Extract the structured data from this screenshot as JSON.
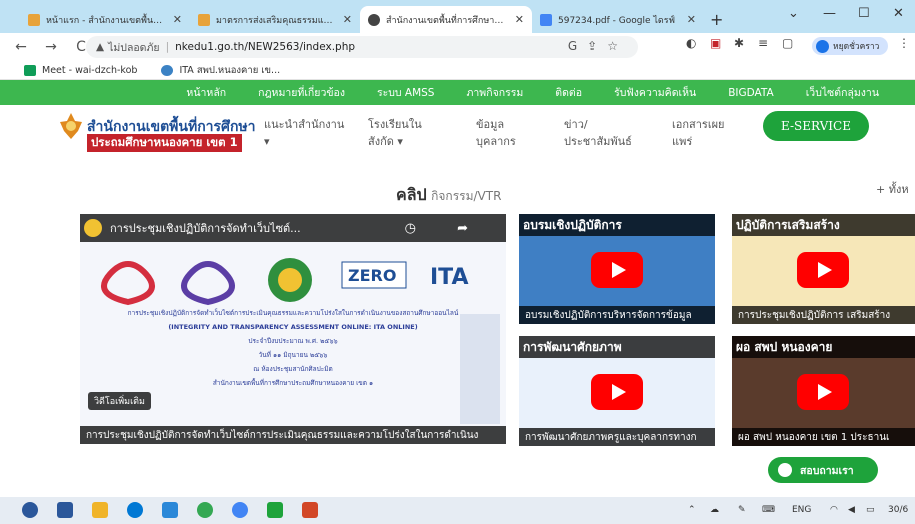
{
  "browser": {
    "tabs": [
      {
        "title": "หน้าแรก - สำนักงานเขตพื้นที่กา",
        "active": false
      },
      {
        "title": "มาตรการส่งเสริมคุณธรรมและความ",
        "active": false
      },
      {
        "title": "สำนักงานเขตพื้นที่การศึกษาประ",
        "active": true
      },
      {
        "title": "597234.pdf - Google ไดรฟ์",
        "active": false
      }
    ],
    "omnibox": {
      "security_label": "ไม่ปลอดภัย",
      "url": "nkedu1.go.th/NEW2563/index.php"
    },
    "profile_label": "หยุดชั่วคราว",
    "bookmarks": [
      {
        "label": "Meet - wai-dzch-kob"
      },
      {
        "label": "ITA สพป.หนองคาย เข..."
      }
    ]
  },
  "site": {
    "topnav": [
      "หน้าหลัก",
      "กฎหมายที่เกี่ยวข้อง",
      "ระบบ AMSS",
      "ภาพกิจกรรม",
      "ติดต่อ",
      "รับฟังความคิดเห็น",
      "BIGDATA",
      "เว็บไซต์กลุ่มงาน"
    ],
    "org_line1": "สำนักงานเขตพื้นที่การศึกษา",
    "org_line2": "ประถมศึกษาหนองคาย เขต 1",
    "menu": [
      {
        "l1": "แนะนำสำนักงาน",
        "l2": "▾"
      },
      {
        "l1": "โรงเรียนใน",
        "l2": "สังกัด ▾"
      },
      {
        "l1": "ข้อมูล",
        "l2": "บุคลากร"
      },
      {
        "l1": "ข่าว/",
        "l2": "ประชาสัมพันธ์"
      },
      {
        "l1": "เอกสารเผย",
        "l2": "แพร่"
      }
    ],
    "eservice_label": "E-SERVICE",
    "section_title_bold": "คลิป",
    "section_title_sub": "กิจกรรม/VTR",
    "more_label": "+ ทั้งห",
    "videos": {
      "main": {
        "title": "การประชุมเชิงปฏิบัติการจัดทำเว็บไซต์...",
        "caption": "การประชุมเชิงปฏิบัติการจัดทำเว็บไซต์การประเมินคุณธรรมและความโปร่งใสในการดำเนินง",
        "subtitle_en": "(INTEGRITY AND TRANSPARENCY ASSESSMENT ONLINE: ITA ONLINE)",
        "line1": "การประชุมเชิงปฏิบัติการจัดทำเว็บไซต์การประเมินคุณธรรมและความโปร่งใสในการดำเนินงานของสถานศึกษาออนไลน์",
        "line2": "ประจำปีงบประมาณ พ.ศ. ๒๕๖๖",
        "line3": "วันที่ ๑๑ มิถุนายน ๒๕๖๖",
        "line4": "ณ ห้องประชุมสานักศิลปะมิต",
        "line5": "สำนักงานเขตพื้นที่การศึกษาประถมศึกษาหนองคาย เขต ๑",
        "watch_more": "วิดีโอเพิ่มเติม"
      },
      "v2": {
        "overlay": "อบรมเชิงปฏิบัติการ",
        "caption": "อบรมเชิงปฏิบัติการบริหารจัดการข้อมูล"
      },
      "v3": {
        "overlay": "ปฏิบัติการเสริมสร้าง",
        "caption": "การประชุมเชิงปฏิบัติการ เสริมสร้าง"
      },
      "v4": {
        "overlay": "การพัฒนาศักยภาพ",
        "caption": "การพัฒนาศักยภาพครูและบุคลากรทางก"
      },
      "v5": {
        "overlay": "ผอ สพป หนองคาย",
        "caption": "ผอ สพป หนองคาย เขต 1 ประธานเ"
      }
    },
    "chat_label": "สอบถามเรา"
  },
  "taskbar": {
    "lang": "ENG",
    "time": "30/6"
  }
}
